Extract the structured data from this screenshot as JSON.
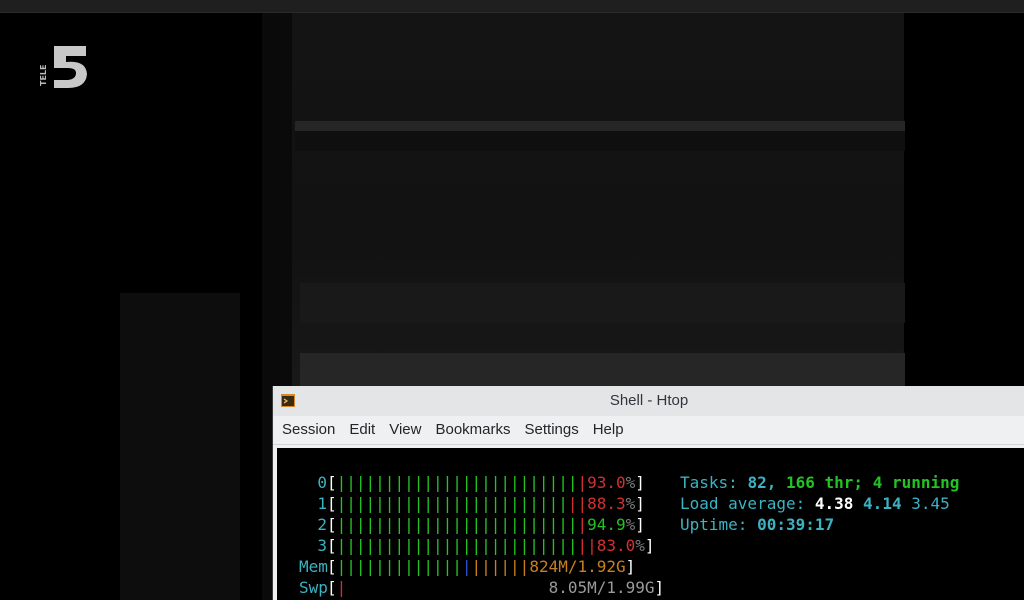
{
  "logo": {
    "text": "TELE",
    "number": "5"
  },
  "window": {
    "title": "Shell - Htop",
    "menu": [
      "Session",
      "Edit",
      "View",
      "Bookmarks",
      "Settings",
      "Help"
    ]
  },
  "htop": {
    "cpus": [
      {
        "label": "0",
        "green": "|||||||||||||||||||||||||",
        "red": "|",
        "value": "93.0",
        "unit": "%"
      },
      {
        "label": "1",
        "green": "||||||||||||||||||||||||",
        "red": "||",
        "value": "88.3",
        "unit": "%"
      },
      {
        "label": "2",
        "green": "|||||||||||||||||||||||||",
        "red": "|",
        "value": "94.9",
        "unit": "%"
      },
      {
        "label": "3",
        "green": "|||||||||||||||||||||||||",
        "red": "||",
        "value": "83.0",
        "unit": "%"
      }
    ],
    "mem": {
      "label": "Mem",
      "green": "|||||||||||||",
      "blue": "|",
      "orange": "||||||",
      "value": "824M/1.92G"
    },
    "swp": {
      "label": "Swp",
      "red": "|",
      "value": "8.05M/1.99G"
    },
    "tasks": {
      "label": "Tasks:",
      "count": "82,",
      "threads": "166",
      "thr_label": "thr;",
      "running": "4",
      "running_label": "running"
    },
    "load": {
      "label": "Load average:",
      "v1": "4.38",
      "v2": "4.14",
      "v3": "3.45"
    },
    "uptime": {
      "label": "Uptime:",
      "value": "00:39:17"
    }
  },
  "colors": {
    "green": "#22c322",
    "red": "#d43030",
    "cyan": "#3bb3c3",
    "orange": "#c8801e",
    "blue": "#3050d0"
  }
}
